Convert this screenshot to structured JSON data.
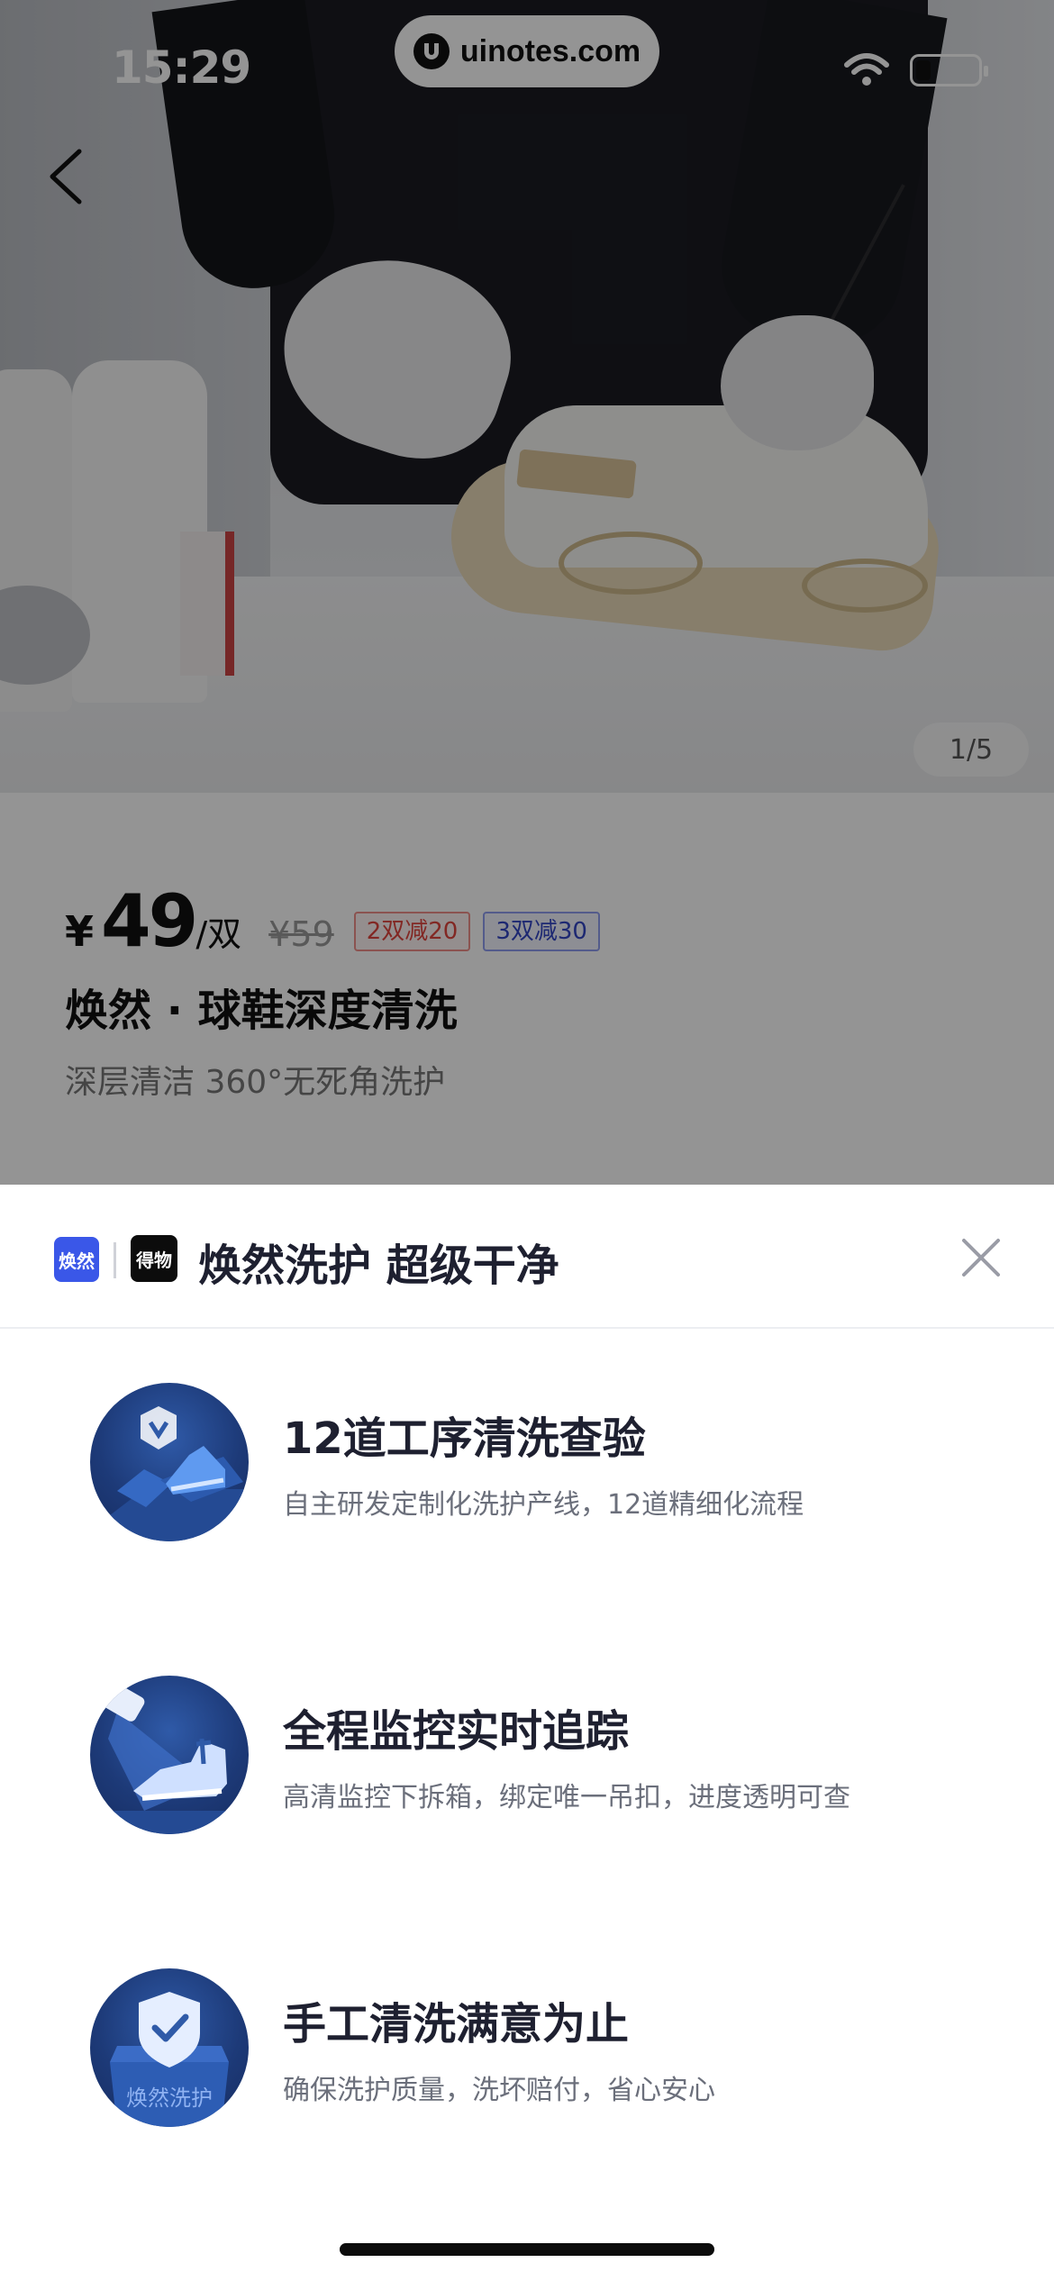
{
  "status_bar": {
    "time": "15:29"
  },
  "watermark": {
    "text": "uinotes.com"
  },
  "gallery": {
    "page_indicator": "1/5"
  },
  "product": {
    "currency": "¥",
    "price": "49",
    "unit": "/双",
    "original_price": "¥59",
    "promo_tags": [
      "2双减20",
      "3双减30"
    ],
    "title": "焕然 · 球鞋深度清洗",
    "subtitle": "深层清洁 360°无死角洗护"
  },
  "sheet": {
    "brand_badges": [
      "焕然",
      "得物"
    ],
    "title": "焕然洗护 超级干净",
    "features": [
      {
        "title": "12道工序清洗查验",
        "description": "自主研发定制化洗护产线，12道精细化流程",
        "icon": "shoe-shield-icon"
      },
      {
        "title": "全程监控实时追踪",
        "description": "高清监控下拆箱，绑定唯一吊扣，进度透明可查",
        "icon": "camera-shoe-icon"
      },
      {
        "title": "手工清洗满意为止",
        "description": "确保洗护质量，洗坏赔付，省心安心",
        "icon": "check-shield-box-icon",
        "badge_text": "焕然洗护"
      }
    ]
  },
  "colors": {
    "brand_blue": "#3a57e8",
    "promo_red": "#e0463e",
    "promo_blue": "#3346c4",
    "badge_navy": "#1d3a78"
  }
}
